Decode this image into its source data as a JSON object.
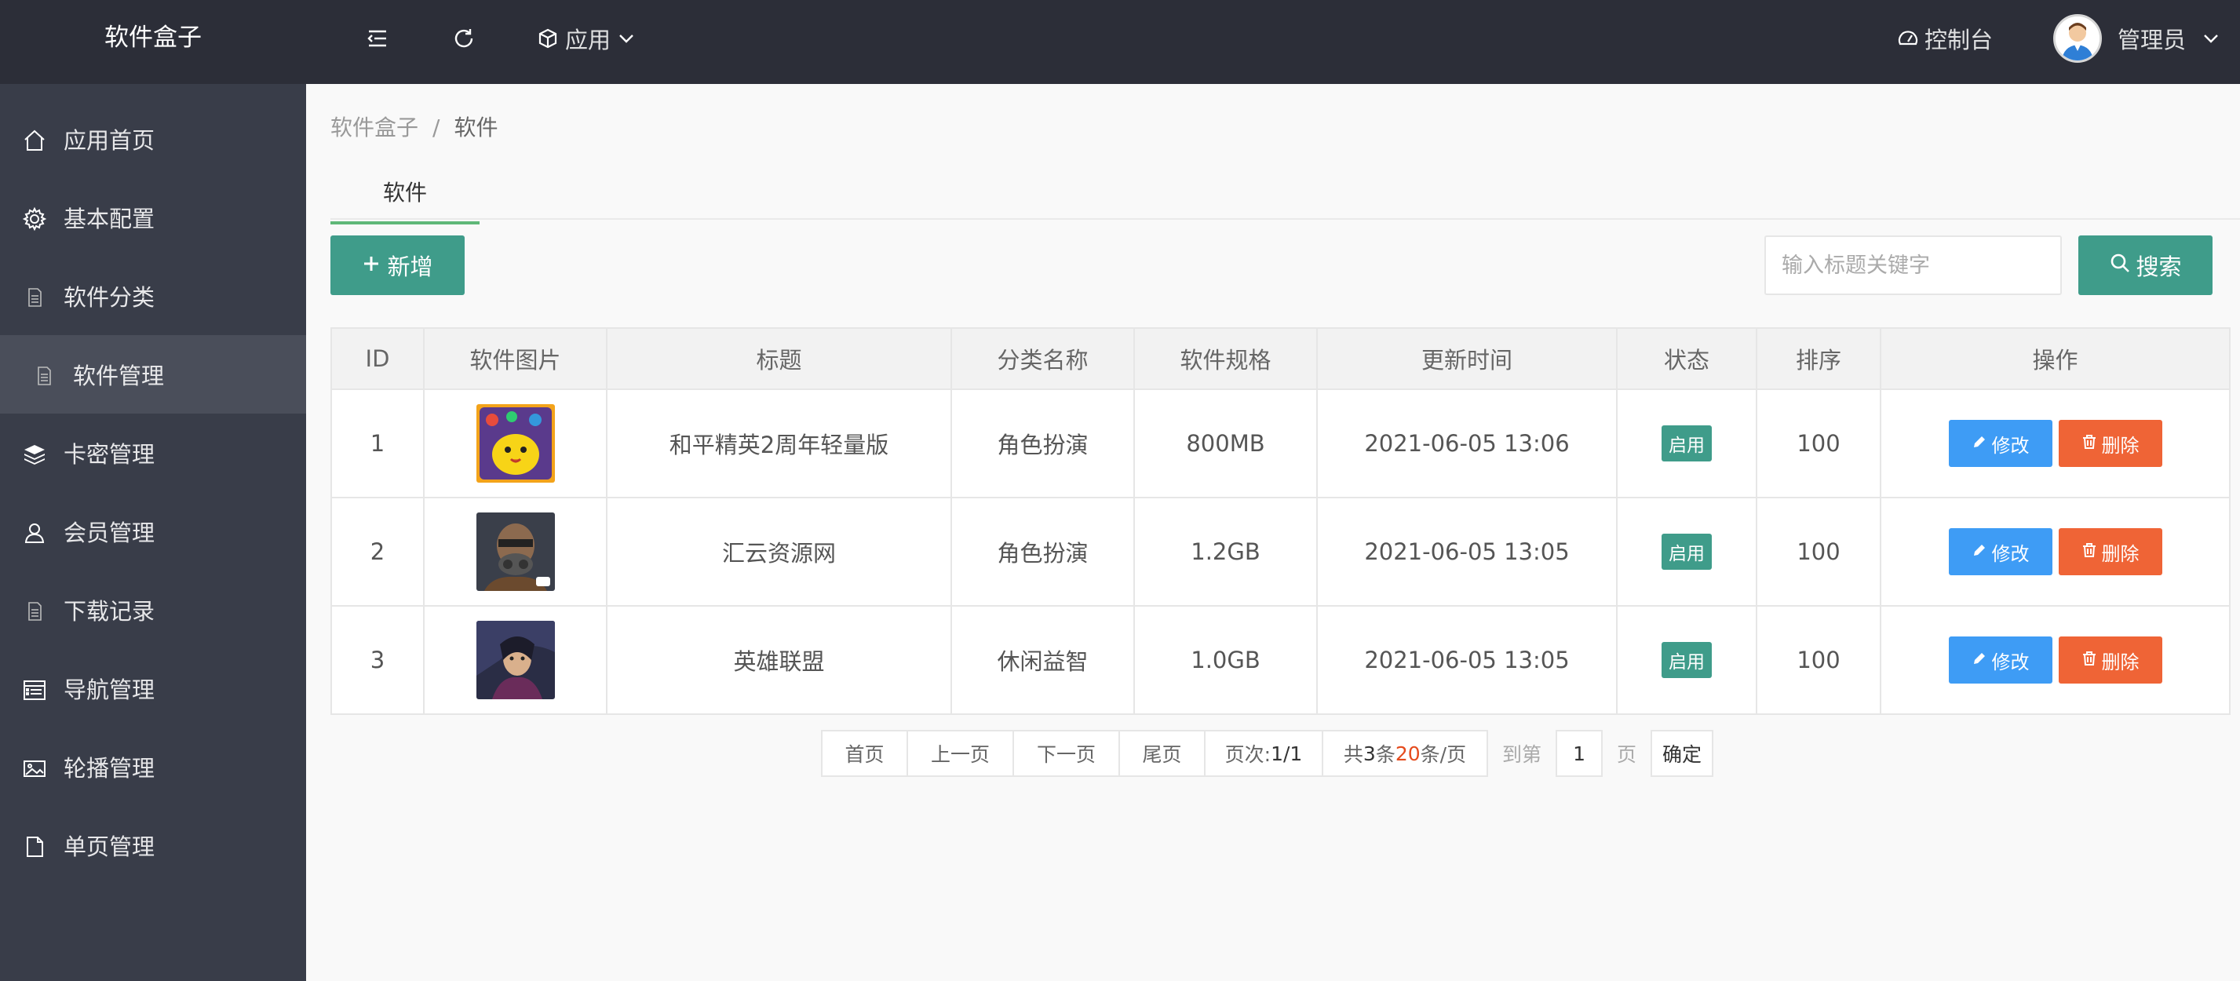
{
  "header": {
    "logo": "软件盒子",
    "app_menu": "应用",
    "console": "控制台",
    "user": "管理员"
  },
  "sidebar": {
    "items": [
      {
        "label": "应用首页",
        "icon": "home-icon"
      },
      {
        "label": "基本配置",
        "icon": "gear-icon"
      },
      {
        "label": "软件分类",
        "icon": "file-icon"
      },
      {
        "label": "软件管理",
        "icon": "file-icon"
      },
      {
        "label": "卡密管理",
        "icon": "layers-icon"
      },
      {
        "label": "会员管理",
        "icon": "user-icon"
      },
      {
        "label": "下载记录",
        "icon": "file-icon"
      },
      {
        "label": "导航管理",
        "icon": "list-icon"
      },
      {
        "label": "轮播管理",
        "icon": "image-icon"
      },
      {
        "label": "单页管理",
        "icon": "document-icon"
      }
    ],
    "active_index": 3
  },
  "breadcrumb": {
    "root": "软件盒子",
    "sep": "/",
    "current": "软件"
  },
  "tab": {
    "label": "软件"
  },
  "toolbar": {
    "add_label": "新增",
    "search_placeholder": "输入标题关键字",
    "search_label": "搜索"
  },
  "table": {
    "columns": [
      "ID",
      "软件图片",
      "标题",
      "分类名称",
      "软件规格",
      "更新时间",
      "状态",
      "排序",
      "操作"
    ],
    "rows": [
      {
        "id": "1",
        "title": "和平精英2周年轻量版",
        "category": "角色扮演",
        "size": "800MB",
        "updated": "2021-06-05 13:06",
        "status": "启用",
        "sort": "100"
      },
      {
        "id": "2",
        "title": "汇云资源网",
        "category": "角色扮演",
        "size": "1.2GB",
        "updated": "2021-06-05 13:05",
        "status": "启用",
        "sort": "100"
      },
      {
        "id": "3",
        "title": "英雄联盟",
        "category": "休闲益智",
        "size": "1.0GB",
        "updated": "2021-06-05 13:05",
        "status": "启用",
        "sort": "100"
      }
    ],
    "edit_label": "修改",
    "delete_label": "删除"
  },
  "pager": {
    "first": "首页",
    "prev": "上一页",
    "next": "下一页",
    "last": "尾页",
    "page_label": "页次:",
    "page_value": "1/1",
    "total_prefix": "共",
    "total_count": "3",
    "total_mid": "条 ",
    "per_page": "20",
    "total_suffix": "条/页",
    "goto_label": "到第",
    "goto_value": "1",
    "goto_unit": "页",
    "confirm": "确定"
  },
  "colors": {
    "header_bg": "#2c2e38",
    "sidebar_bg": "#393d49",
    "primary": "#3f9c8a",
    "edit": "#3e9cf5",
    "delete": "#ef6436"
  }
}
